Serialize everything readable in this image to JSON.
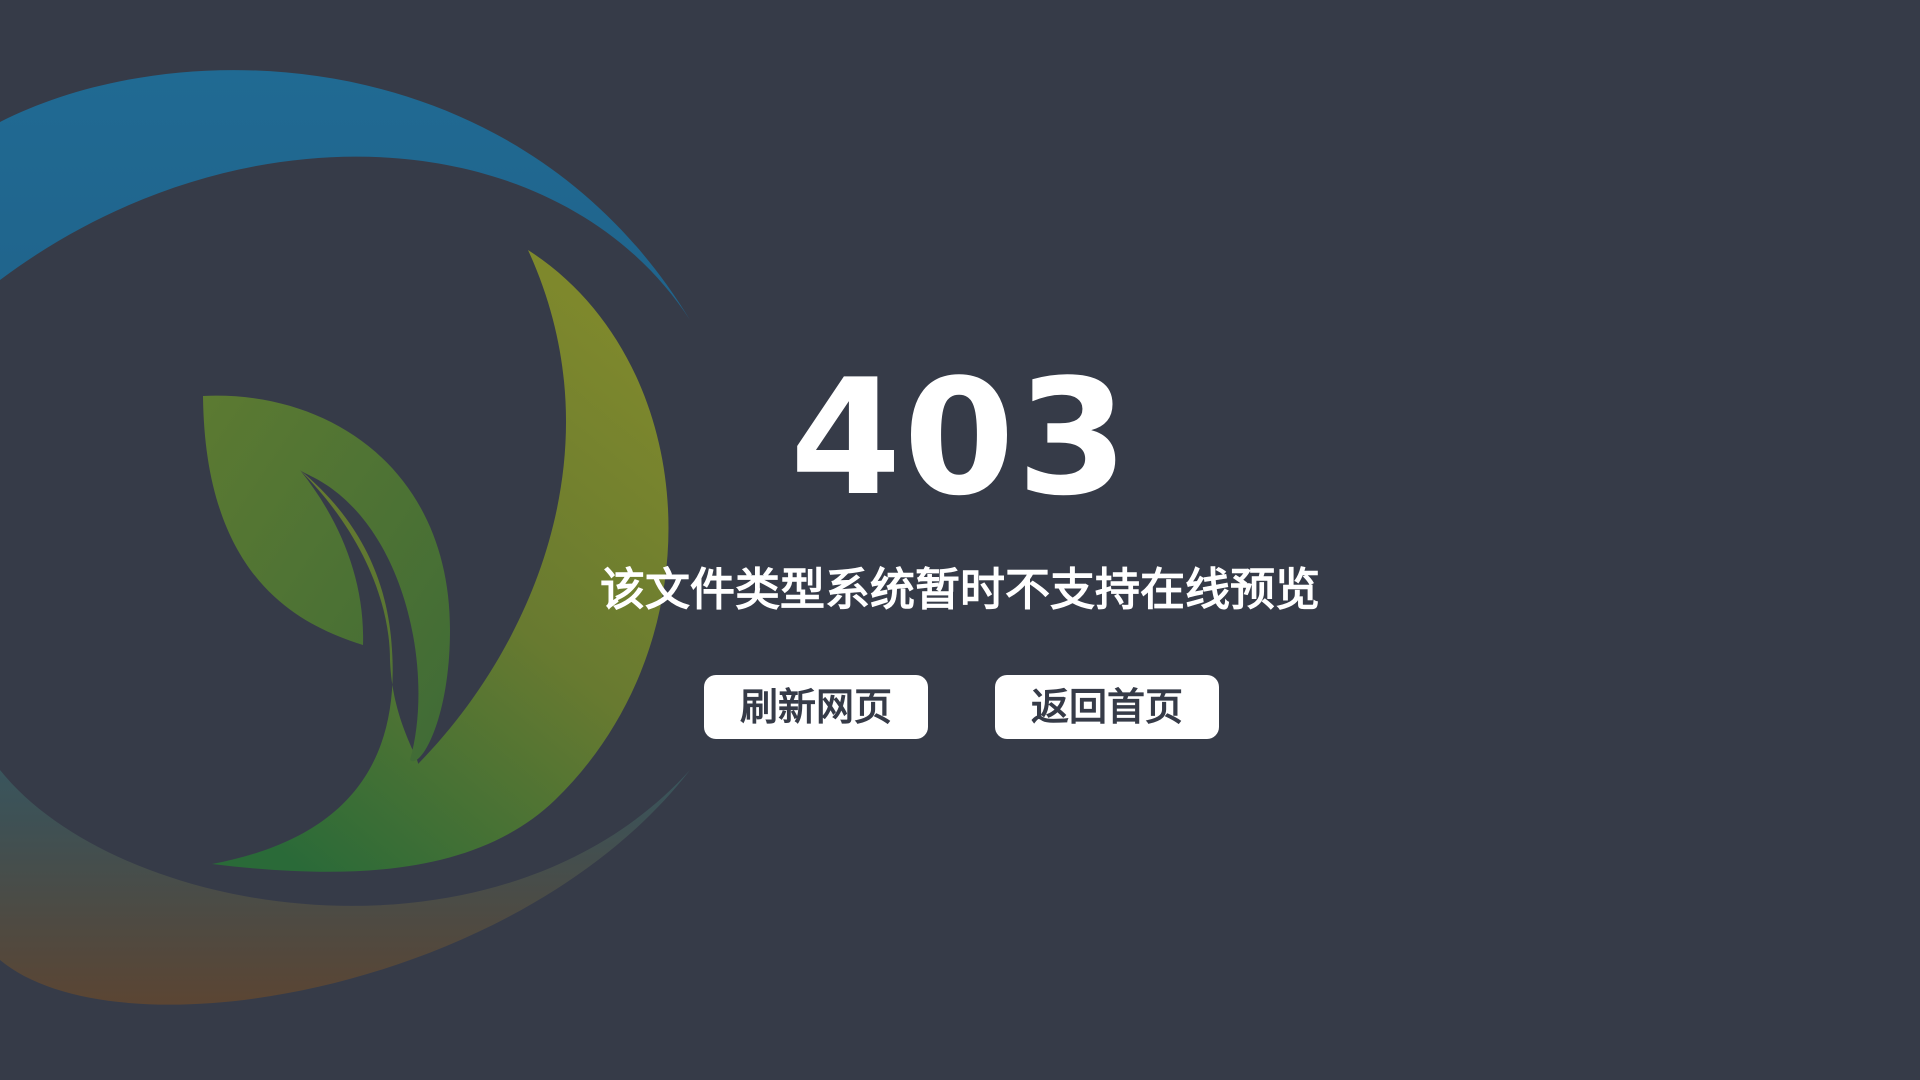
{
  "error": {
    "code": "403",
    "message": "该文件类型系统暂时不支持在线预览"
  },
  "actions": {
    "refresh_label": "刷新网页",
    "home_label": "返回首页"
  },
  "colors": {
    "background": "#363b48",
    "button_background": "#ffffff",
    "button_text": "#363b48",
    "text": "#ffffff",
    "logo_blue": "#206a93",
    "logo_olive": "#737d2b",
    "logo_green": "#2a6a38",
    "logo_brown": "#5b4533"
  },
  "icons": {
    "logo": "leaf-sprout-swirl-logo"
  }
}
